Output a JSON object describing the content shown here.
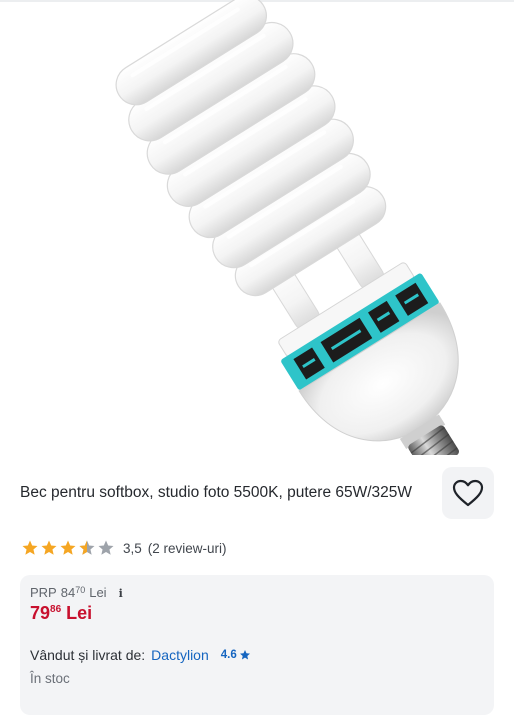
{
  "product": {
    "title": "Bec pentru softbox, studio foto 5500K, putere 65W/325W",
    "image_alt": "spiral-fluorescent-bulb"
  },
  "actions": {
    "favorite_icon": "heart-outline-icon"
  },
  "rating": {
    "value": "3,5",
    "stars_value": 3.5,
    "stars_max": 5,
    "reviews": "(2 review-uri)"
  },
  "pricing": {
    "prp_label": "PRP",
    "prp_whole": "84",
    "prp_cents": "70",
    "prp_currency": "Lei",
    "info_glyph": "i",
    "price_whole": "79",
    "price_cents": "86",
    "price_currency": "Lei"
  },
  "seller": {
    "label": "Vândut și livrat de:",
    "name": "Dactylion",
    "score": "4.6"
  },
  "stock": {
    "status": "În stoc"
  },
  "colors": {
    "price_red": "#c8102e",
    "link_blue": "#1565c0",
    "star_gold": "#f5a623",
    "band_teal": "#2ec4c9"
  }
}
